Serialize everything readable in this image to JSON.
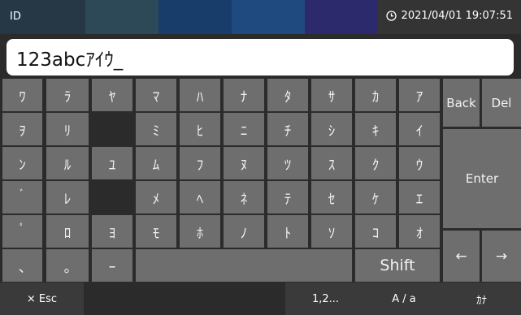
{
  "header": {
    "title": "ID",
    "datetime": "2021/04/01 19:07:51",
    "segment_colors": [
      "#253a4a",
      "#2c4a5a",
      "#173e6e",
      "#1e4b82",
      "#2d2a6e",
      "#343434"
    ]
  },
  "input": {
    "value": "123abcｱｲｳ_"
  },
  "keys": {
    "col1": [
      "ﾜ",
      "ｦ",
      "ﾝ",
      "ﾟ",
      "ﾟ",
      "､"
    ],
    "col2": [
      "ﾗ",
      "ﾘ",
      "ﾙ",
      "ﾚ",
      "ﾛ",
      "｡"
    ],
    "col3": [
      "ﾔ",
      "",
      "ﾕ",
      "",
      "ﾖ",
      "ｰ"
    ],
    "col4": [
      "ﾏ",
      "ﾐ",
      "ﾑ",
      "ﾒ",
      "ﾓ"
    ],
    "col5": [
      "ﾊ",
      "ﾋ",
      "ﾌ",
      "ﾍ",
      "ﾎ"
    ],
    "col6": [
      "ﾅ",
      "ﾆ",
      "ﾇ",
      "ﾈ",
      "ﾉ"
    ],
    "col7": [
      "ﾀ",
      "ﾁ",
      "ﾂ",
      "ﾃ",
      "ﾄ"
    ],
    "col8": [
      "ｻ",
      "ｼ",
      "ｽ",
      "ｾ",
      "ｿ"
    ],
    "col9": [
      "ｶ",
      "ｷ",
      "ｸ",
      "ｹ",
      "ｺ"
    ],
    "col10": [
      "ｱ",
      "ｲ",
      "ｳ",
      "ｴ",
      "ｵ"
    ],
    "row4_col1": "ﾟ",
    "row3_col1": "ﾞ"
  },
  "controls": {
    "back": "Back",
    "del": "Del",
    "enter": "Enter",
    "shift": "Shift",
    "left_arrow": "←",
    "right_arrow": "→"
  },
  "bottom": {
    "esc": "× Esc",
    "numbers": "1,2...",
    "case": "A / a",
    "kana": "ｶﾅ"
  }
}
